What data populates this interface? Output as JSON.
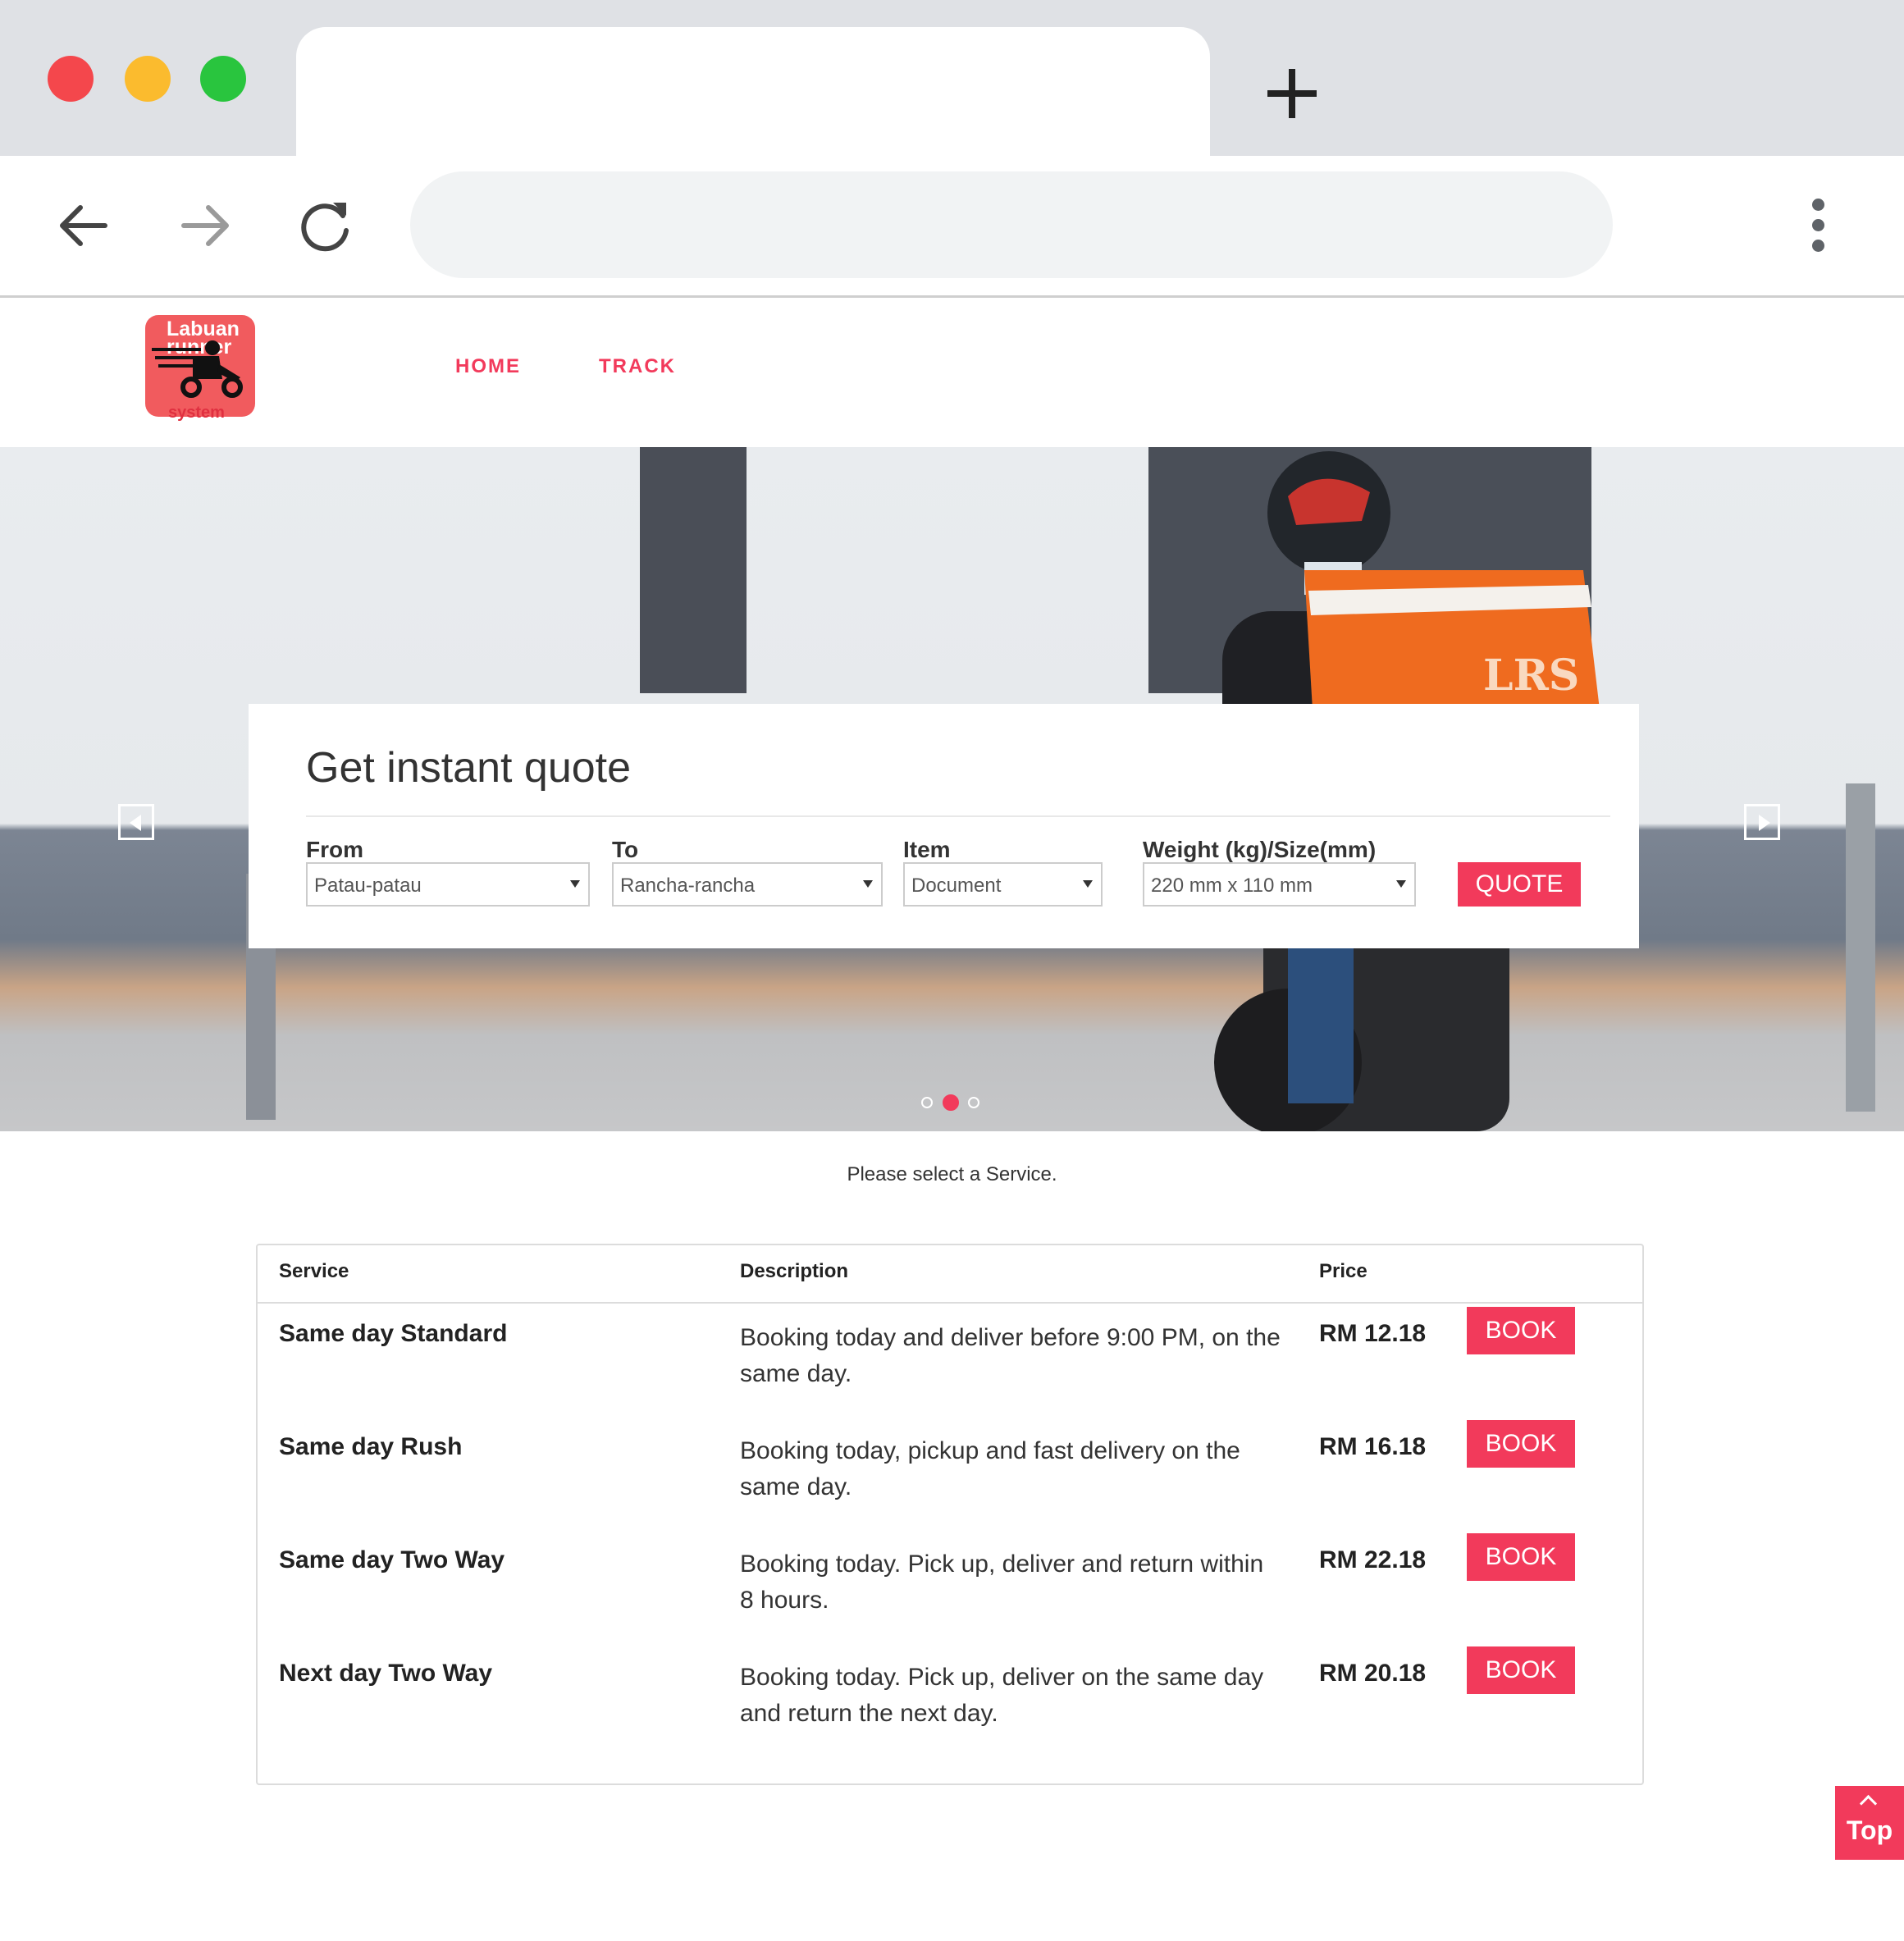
{
  "browser": {
    "address": "",
    "tab_title": ""
  },
  "logo": {
    "line1": "Labuan",
    "line2": "runner",
    "line3": "system",
    "color": "#f15b5e"
  },
  "nav": {
    "items": [
      {
        "label": "HOME"
      },
      {
        "label": "TRACK"
      }
    ]
  },
  "hero": {
    "bag_text": "LRS",
    "slides_total": 3,
    "active_slide": 2
  },
  "quote": {
    "title": "Get instant quote",
    "fields": [
      {
        "label": "From",
        "value": "Patau-patau"
      },
      {
        "label": "To",
        "value": "Rancha-rancha"
      },
      {
        "label": "Item",
        "value": "Document"
      },
      {
        "label": "Weight (kg)/Size(mm)",
        "value": "220 mm x 110 mm"
      }
    ],
    "button": "QUOTE"
  },
  "services": {
    "hint": "Please select a Service.",
    "columns": [
      "Service",
      "Description",
      "Price"
    ],
    "rows": [
      {
        "name": "Same day Standard",
        "description": "Booking today and deliver before 9:00 PM, on the same day.",
        "price": "RM 12.18",
        "action": "BOOK"
      },
      {
        "name": "Same day Rush",
        "description": "Booking today, pickup and fast delivery on the same day.",
        "price": "RM 16.18",
        "action": "BOOK"
      },
      {
        "name": "Same day Two Way",
        "description": "Booking today. Pick up, deliver and return within 8 hours.",
        "price": "RM 22.18",
        "action": "BOOK"
      },
      {
        "name": "Next day Two Way",
        "description": "Booking today. Pick up, deliver on the same day and return the next day.",
        "price": "RM 20.18",
        "action": "BOOK"
      }
    ]
  },
  "back_to_top": "Top",
  "colors": {
    "accent": "#f23a5b",
    "chrome": "#dfe1e5"
  }
}
